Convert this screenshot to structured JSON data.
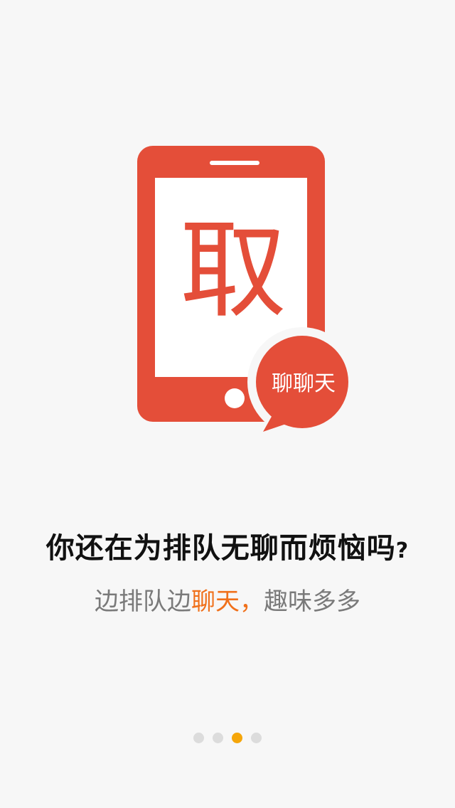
{
  "colors": {
    "brand_red": "#e44e39",
    "accent_orange": "#f0701a",
    "dot_active": "#f5a60a",
    "dot_inactive": "#dcdcdc",
    "background": "#f7f7f7"
  },
  "illustration": {
    "phone_icon": "phone-icon",
    "screen_glyph": "取",
    "bubble_text": "聊聊天"
  },
  "headline": {
    "text": "你还在为排队无聊而烦恼吗",
    "question_mark": "?"
  },
  "subline": {
    "part1": "边排队边",
    "highlight": "聊天，",
    "part2": "趣味多多"
  },
  "pager": {
    "total": 4,
    "current": 3
  }
}
